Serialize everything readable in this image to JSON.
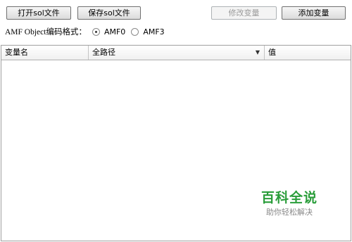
{
  "toolbar": {
    "open_label": "打开sol文件",
    "save_label": "保存sol文件",
    "modify_label": "修改变量",
    "add_label": "添加变量"
  },
  "encoding": {
    "label": "AMF Object编码格式：",
    "options": [
      "AMF0",
      "AMF3"
    ],
    "selected": "AMF0"
  },
  "table": {
    "columns": [
      "变量名",
      "全路径",
      "值"
    ]
  },
  "watermark": {
    "title": "百科全说",
    "subtitle": "助你轻松解决"
  }
}
